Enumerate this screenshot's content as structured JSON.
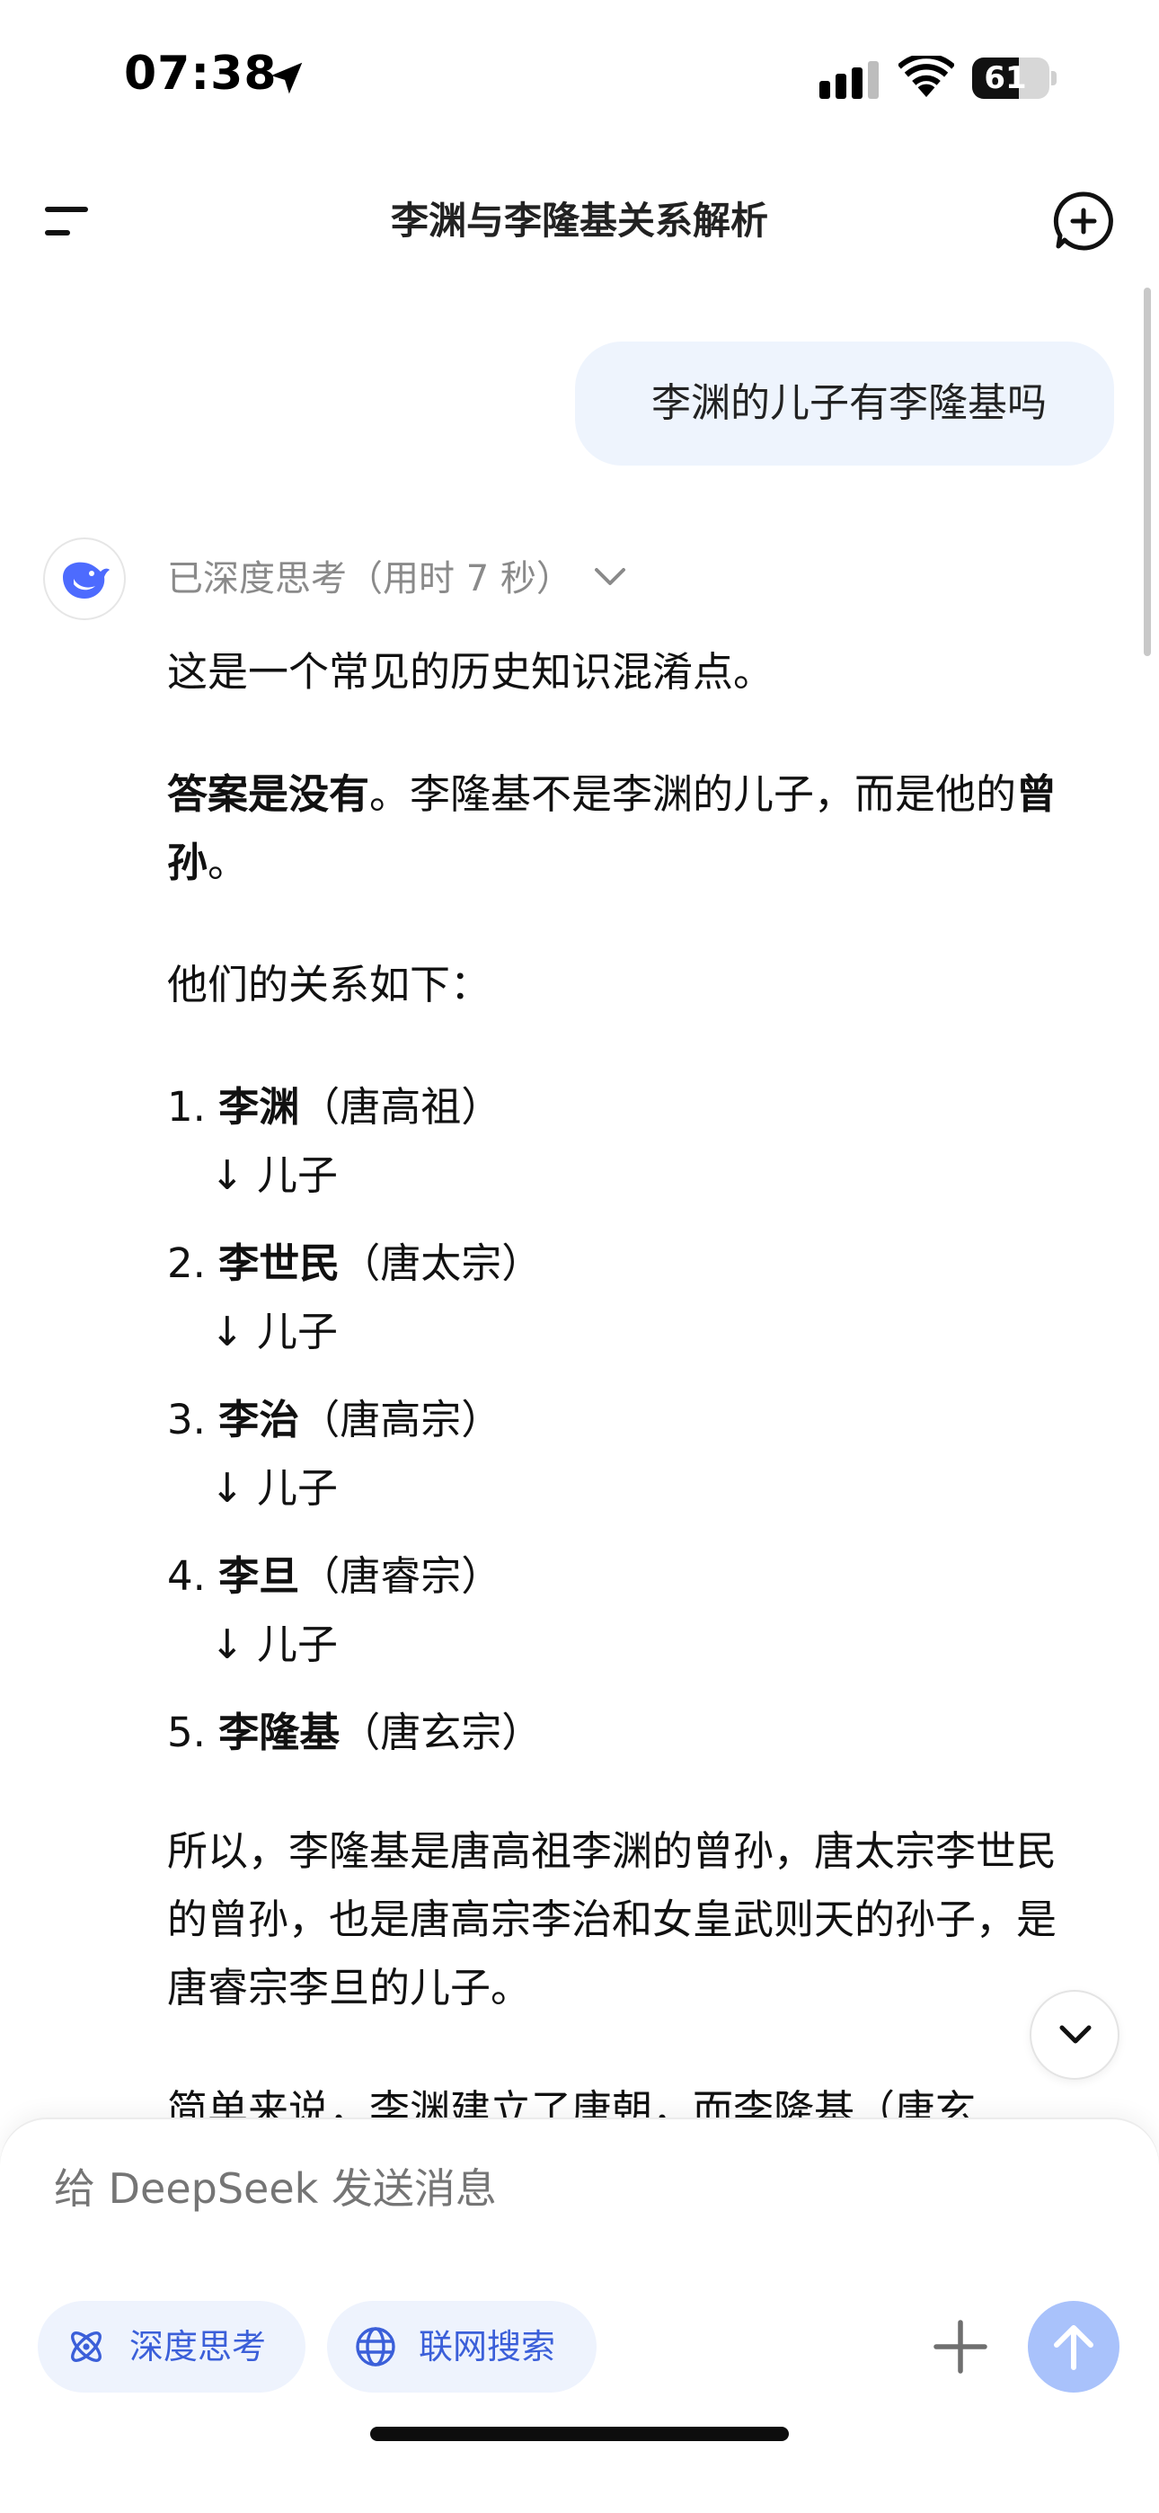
{
  "status_bar": {
    "time": "07:38",
    "battery": "61",
    "battery_level_percent": 61
  },
  "header": {
    "title": "李渊与李隆基关系解析"
  },
  "user_message": {
    "text": "李渊的儿子有李隆基吗"
  },
  "assistant": {
    "thinking_label": "已深度思考（用时 7 秒）",
    "intro": "这是一个常见的历史知识混淆点。",
    "answer_bold": "答案是没有",
    "answer_rest_1": "。李隆基不是李渊的儿子，而是他的",
    "answer_bold_2": "曾孙",
    "answer_rest_2": "。",
    "relation_heading": "他们的关系如下：",
    "lineage": [
      {
        "num": "1.",
        "name": "李渊",
        "title": "（唐高祖）",
        "rel": "↓ 儿子"
      },
      {
        "num": "2.",
        "name": "李世民",
        "title": "（唐太宗）",
        "rel": "↓ 儿子"
      },
      {
        "num": "3.",
        "name": "李治",
        "title": "（唐高宗）",
        "rel": "↓ 儿子"
      },
      {
        "num": "4.",
        "name": "李旦",
        "title": "（唐睿宗）",
        "rel": "↓ 儿子"
      },
      {
        "num": "5.",
        "name": "李隆基",
        "title": "（唐玄宗）",
        "rel": ""
      }
    ],
    "conclusion": "所以，李隆基是唐高祖李渊的曾孙，唐太宗李世民的曾孙，也是唐高宗李治和女皇武则天的孙子，是唐睿宗李旦的儿子。",
    "cut_line": "简单来说，李渊建立了唐朝，而李隆基（唐玄"
  },
  "composer": {
    "placeholder": "给 DeepSeek 发送消息",
    "chip_deep_think": "深度思考",
    "chip_web_search": "联网搜索"
  },
  "colors": {
    "accent": "#3b5fd9",
    "send_button": "#a9c2fb",
    "user_bubble": "#eef4fd",
    "chip_bg": "#eef3fd",
    "thinking_text": "#8a8a8a"
  },
  "icons": {
    "location": "location-arrow-icon",
    "signal": "cellular-signal-icon",
    "wifi": "wifi-icon",
    "menu": "menu-icon",
    "new_chat": "new-chat-icon",
    "avatar": "deepseek-whale-icon",
    "thinking_toggle": "chevron-down-icon",
    "scroll_down": "chevron-down-icon",
    "deep_think": "atom-icon",
    "web_search": "globe-icon",
    "attach": "plus-icon",
    "send": "arrow-up-icon"
  }
}
